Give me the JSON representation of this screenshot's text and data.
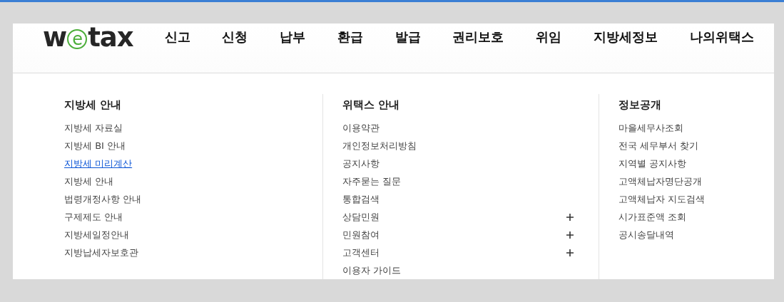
{
  "logo": {
    "before": "w",
    "circled": "e",
    "after": "tax"
  },
  "nav": [
    {
      "label": "신고"
    },
    {
      "label": "신청"
    },
    {
      "label": "납부"
    },
    {
      "label": "환급"
    },
    {
      "label": "발급"
    },
    {
      "label": "권리보호"
    },
    {
      "label": "위임"
    },
    {
      "label": "지방세정보"
    },
    {
      "label": "나의위택스"
    }
  ],
  "menu_columns": [
    {
      "heading": "지방세 안내",
      "items": [
        {
          "label": "지방세 자료실",
          "selected": false,
          "expandable": false
        },
        {
          "label": "지방세 BI 안내",
          "selected": false,
          "expandable": false
        },
        {
          "label": "지방세 미리계산",
          "selected": true,
          "expandable": false
        },
        {
          "label": "지방세 안내",
          "selected": false,
          "expandable": false
        },
        {
          "label": "법령개정사항 안내",
          "selected": false,
          "expandable": false
        },
        {
          "label": "구제제도 안내",
          "selected": false,
          "expandable": false
        },
        {
          "label": "지방세일정안내",
          "selected": false,
          "expandable": false
        },
        {
          "label": "지방납세자보호관",
          "selected": false,
          "expandable": false
        }
      ]
    },
    {
      "heading": "위택스 안내",
      "items": [
        {
          "label": "이용약관",
          "selected": false,
          "expandable": false
        },
        {
          "label": "개인정보처리방침",
          "selected": false,
          "expandable": false
        },
        {
          "label": "공지사항",
          "selected": false,
          "expandable": false
        },
        {
          "label": "자주묻는 질문",
          "selected": false,
          "expandable": false
        },
        {
          "label": "통합검색",
          "selected": false,
          "expandable": false
        },
        {
          "label": "상담민원",
          "selected": false,
          "expandable": true
        },
        {
          "label": "민원참여",
          "selected": false,
          "expandable": true
        },
        {
          "label": "고객센터",
          "selected": false,
          "expandable": true
        },
        {
          "label": "이용자 가이드",
          "selected": false,
          "expandable": false
        }
      ]
    },
    {
      "heading": "정보공개",
      "items": [
        {
          "label": "마을세무사조회",
          "selected": false,
          "expandable": false
        },
        {
          "label": "전국 세무부서 찾기",
          "selected": false,
          "expandable": false
        },
        {
          "label": "지역별 공지사항",
          "selected": false,
          "expandable": false
        },
        {
          "label": "고액체납자명단공개",
          "selected": false,
          "expandable": false
        },
        {
          "label": "고액체납자 지도검색",
          "selected": false,
          "expandable": false
        },
        {
          "label": "시가표준액 조회",
          "selected": false,
          "expandable": false
        },
        {
          "label": "공시송달내역",
          "selected": false,
          "expandable": false
        }
      ]
    }
  ]
}
